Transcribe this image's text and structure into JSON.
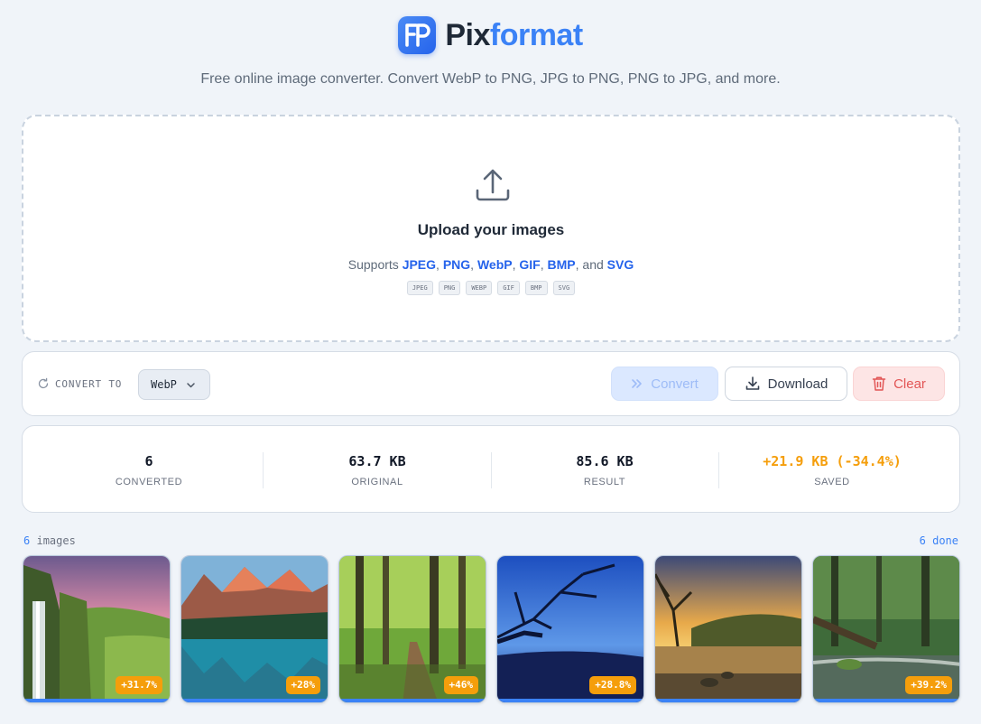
{
  "app": {
    "brand_part1": "Pix",
    "brand_part2": "format",
    "tagline": "Free online image converter. Convert WebP to PNG, JPG to PNG, PNG to JPG, and more."
  },
  "upload": {
    "title": "Upload your images",
    "supports_prefix": "Supports",
    "formats": [
      "JPEG",
      "PNG",
      "WebP",
      "GIF",
      "BMP",
      "SVG"
    ],
    "sep1": ",",
    "sep2": ",",
    "sep3": ",",
    "sep4": ",",
    "and_word": ", and",
    "badges": [
      "JPEG",
      "PNG",
      "WEBP",
      "GIF",
      "BMP",
      "SVG"
    ]
  },
  "toolbar": {
    "convert_to_label": "CONVERT TO",
    "selected_format": "WebP",
    "convert_label": "Convert",
    "download_label": "Download",
    "clear_label": "Clear"
  },
  "stats": [
    {
      "value": "6",
      "label": "CONVERTED"
    },
    {
      "value": "63.7 KB",
      "label": "ORIGINAL"
    },
    {
      "value": "85.6 KB",
      "label": "RESULT"
    },
    {
      "value": "+21.9 KB (-34.4%)",
      "label": "SAVED"
    }
  ],
  "gallery": {
    "count_number": "6",
    "count_word": "images",
    "done_label": "6 done",
    "items": [
      {
        "change": "+31.7%",
        "scene": "waterfall"
      },
      {
        "change": "+28%",
        "scene": "mountain-lake"
      },
      {
        "change": "+46%",
        "scene": "forest-path"
      },
      {
        "change": "+28.8%",
        "scene": "blue-tree"
      },
      {
        "change": "",
        "scene": "sunset-lake"
      },
      {
        "change": "+39.2%",
        "scene": "forest-stream"
      }
    ]
  },
  "colors": {
    "accent": "#3b82f6",
    "warning": "#f59e0b",
    "danger": "#e25555",
    "background": "#f0f4f9"
  }
}
